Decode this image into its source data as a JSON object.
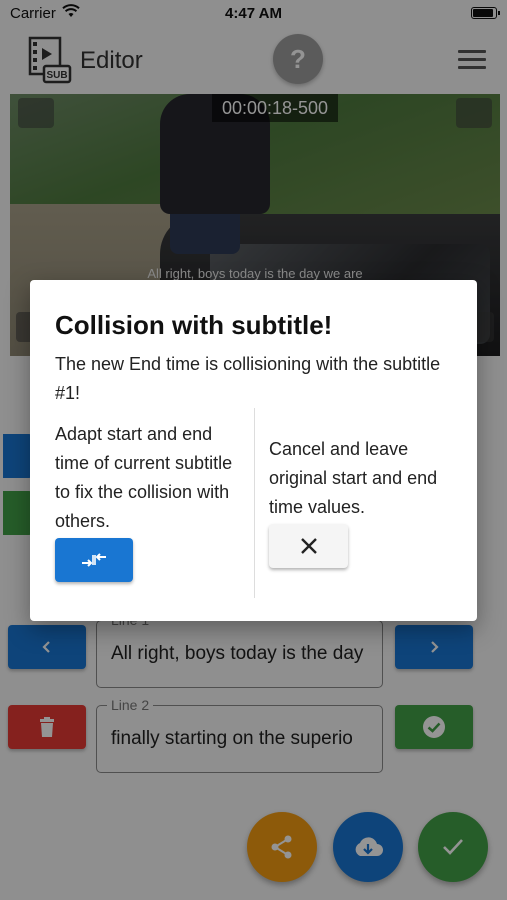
{
  "status_bar": {
    "carrier": "Carrier",
    "time": "4:47 AM"
  },
  "app_bar": {
    "title": "Editor",
    "help_label": "?"
  },
  "video": {
    "timecode": "00:00:18-500",
    "subtitle_preview": "All right, boys today is the day we are"
  },
  "editor": {
    "line1": {
      "label": "Line 1",
      "value": "All right, boys today is the day"
    },
    "line2": {
      "label": "Line 2",
      "value": "finally starting on the superio"
    }
  },
  "dialog": {
    "title": "Collision with subtitle!",
    "message": "The new End time is collisioning with the subtitle #1!",
    "adapt_option": "Adapt start and end time of current subtitle to fix the collision with others.",
    "cancel_option": "Cancel and leave original start and end time values."
  },
  "colors": {
    "primary": "#1976d2",
    "success": "#43a047",
    "danger": "#e53935",
    "share": "#f39c12"
  }
}
